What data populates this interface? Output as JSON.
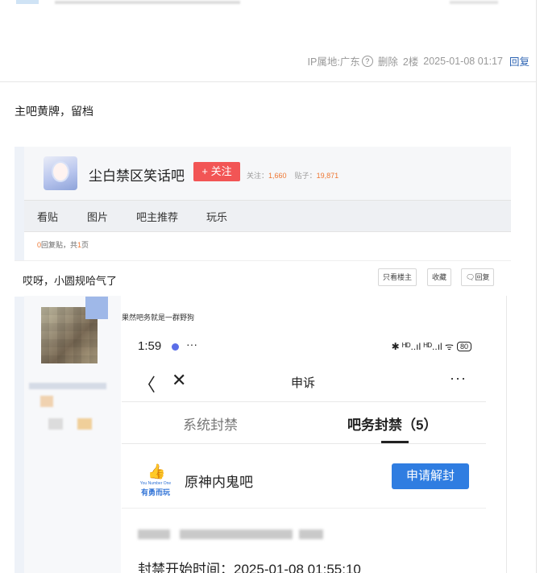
{
  "post_meta": {
    "ip_location": "IP属地:广东",
    "help_icon": "?",
    "delete_label": "删除",
    "floor": "2楼",
    "datetime": "2025-01-08 01:17",
    "reply_label": "回复"
  },
  "post": {
    "text": "主吧黄牌，留档"
  },
  "screenshot": {
    "bar_name": "尘白禁区笑话吧",
    "follow_label": "+ 关注",
    "stats_follow_label": "关注：",
    "stats_follow_value": "1,660",
    "stats_posts_label": "贴子：",
    "stats_posts_value": "19,871",
    "tabs": [
      "看贴",
      "图片",
      "吧主推荐",
      "玩乐"
    ],
    "reply_count_value": "0",
    "reply_count_mid": "回复贴，共",
    "page_value": "1",
    "page_suffix": "页",
    "thread_title": "哎呀，小圆规哈气了",
    "buttons": {
      "only_op": "只看楼主",
      "collect": "收藏",
      "reply": "回复"
    },
    "floor_caption": "果然吧务就是一群野狗",
    "phone": {
      "time": "1:59",
      "more_dots": "···",
      "status_icons": "✱ ᴴᴰ..ıl ᴴᴰ..ıl ᯤ",
      "battery": "80",
      "back_glyph": "〈",
      "close_glyph": "✕",
      "nav_title": "申诉",
      "nav_more": "···",
      "segment_system": "系统封禁",
      "segment_bar": "吧务封禁（5）",
      "logo_thumb": "👍",
      "logo_line1": "You Number One",
      "logo_line2": "有勇而玩",
      "ban_bar_name": "原神内鬼吧",
      "unban_label": "申请解封",
      "ban_start": "封禁开始时间：2025-01-08 01:55:10"
    }
  }
}
